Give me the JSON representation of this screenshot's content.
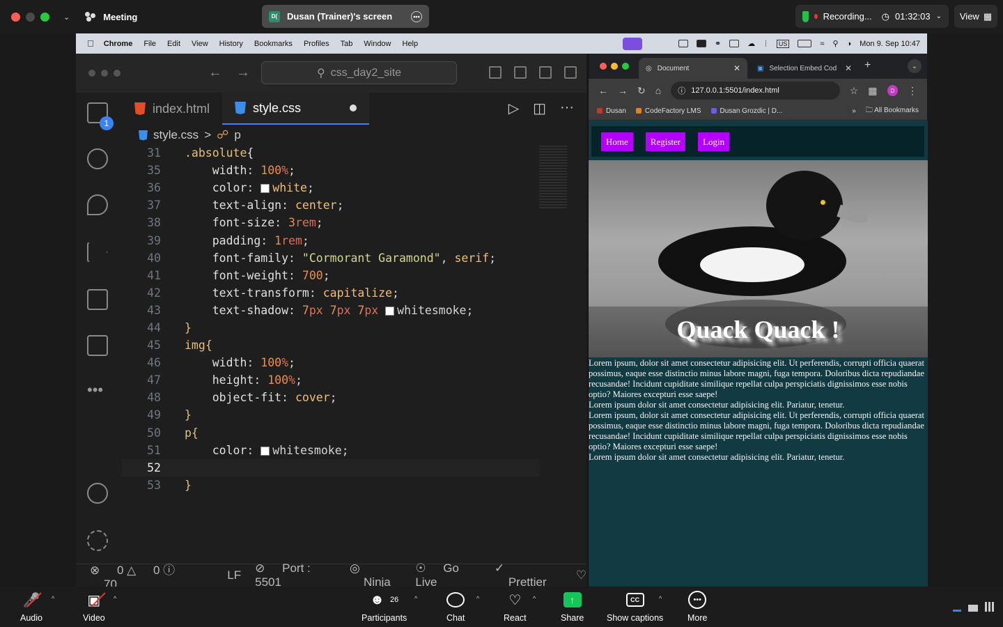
{
  "zoom": {
    "meeting_label": "Meeting",
    "shared_screen": "Dusan (Trainer)'s screen",
    "sharer_initials": "D(",
    "recording_label": "Recording...",
    "timer": "01:32:03",
    "view_label": "View",
    "participants_count": "26",
    "toolbar": {
      "audio": "Audio",
      "video": "Video",
      "participants": "Participants",
      "chat": "Chat",
      "react": "React",
      "share": "Share",
      "captions": "Show captions",
      "more": "More"
    }
  },
  "mac_menu": {
    "app": "Chrome",
    "items": [
      "File",
      "Edit",
      "View",
      "History",
      "Bookmarks",
      "Profiles",
      "Tab",
      "Window",
      "Help"
    ],
    "datetime": "Mon 9. Sep  10:47",
    "keyboard": "US"
  },
  "vscode": {
    "search": "css_day2_site",
    "tabs": [
      {
        "label": "index.html"
      },
      {
        "label": "style.css"
      }
    ],
    "explorer_badge": "1",
    "breadcrumb": {
      "file": "style.css",
      "symbol": "p"
    },
    "status": {
      "errors": "0",
      "warnings": "0",
      "info": "70",
      "eol": "LF",
      "port": "Port : 5501",
      "ninja": "Ninja",
      "golive": "Go Live",
      "prettier": "Prettier"
    }
  },
  "browser": {
    "tabs": [
      {
        "title": "Document"
      },
      {
        "title": "Selection Embed Cod"
      }
    ],
    "url": "127.0.0.1:5501/index.html",
    "profile_initial": "D",
    "bookmarks": [
      "Dusan",
      "CodeFactory LMS",
      "Dusan Grozdic | D..."
    ],
    "all_bookmarks": "All Bookmarks",
    "nav": [
      "Home",
      "Register",
      "Login"
    ],
    "hero_title": "Quack Quack !",
    "paragraphs": [
      "Lorem ipsum, dolor sit amet consectetur adipisicing elit. Ut perferendis, corrupti officia quaerat possimus, eaque esse distinctio minus labore magni, fuga tempora. Doloribus dicta repudiandae recusandae! Incidunt cupiditate similique repellat culpa perspiciatis dignissimos esse nobis optio? Maiores excepturi esse saepe!",
      "Lorem ipsum dolor sit amet consectetur adipisicing elit. Pariatur, tenetur.",
      "Lorem ipsum, dolor sit amet consectetur adipisicing elit. Ut perferendis, corrupti officia quaerat possimus, eaque esse distinctio minus labore magni, fuga tempora. Doloribus dicta repudiandae recusandae! Incidunt cupiditate similique repellat culpa perspiciatis dignissimos esse nobis optio? Maiores excepturi esse saepe!",
      "Lorem ipsum dolor sit amet consectetur adipisicing elit. Pariatur, tenetur."
    ]
  }
}
